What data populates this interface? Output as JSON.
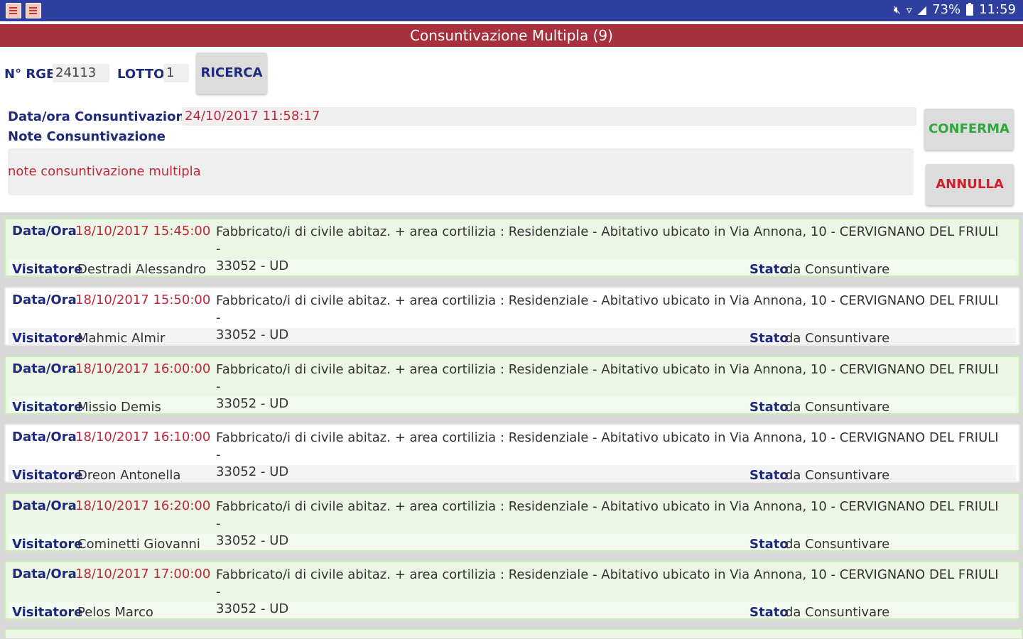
{
  "statusbar": {
    "battery": "73%",
    "time": "11:59",
    "mute_icon": "mute-icon",
    "wifi_icon": "wifi-icon",
    "signal_icon": "signal-icon"
  },
  "title": "Consuntivazione Multipla (9)",
  "search": {
    "rge_label": "N° RGE",
    "rge_value": "24113",
    "lotto_label": "LOTTO",
    "lotto_value": "1",
    "button": "RICERCA"
  },
  "form": {
    "date_label": "Data/ora Consuntivazione",
    "date_value": "24/10/2017 11:58:17",
    "notes_label": "Note Consuntivazione",
    "notes_value": "note consuntivazione multipla",
    "confirm": "CONFERMA",
    "cancel": "ANNULLA"
  },
  "labels": {
    "date": "Data/Ora",
    "visitor": "Visitatore",
    "status": "Stato"
  },
  "colors": {
    "statusbar": "#2f3f9f",
    "titlebar": "#a8303c",
    "label_blue": "#1f2a7a",
    "value_red": "#c0283a",
    "confirm_green": "#2fa83a"
  },
  "items": [
    {
      "date": "18/10/2017 15:45:00",
      "desc_line1": "Fabbricato/i di civile abitaz. + area cortilizia : Residenziale - Abitativo ubicato in Via Annona, 10 - CERVIGNANO DEL FRIULI -",
      "desc_line2": "33052 - UD",
      "visitor": "Destradi Alessandro",
      "status": "da Consuntivare"
    },
    {
      "date": "18/10/2017 15:50:00",
      "desc_line1": "Fabbricato/i di civile abitaz. + area cortilizia : Residenziale - Abitativo ubicato in Via Annona, 10 - CERVIGNANO DEL FRIULI -",
      "desc_line2": "33052 - UD",
      "visitor": "Mahmic Almir",
      "status": "da Consuntivare"
    },
    {
      "date": "18/10/2017 16:00:00",
      "desc_line1": "Fabbricato/i di civile abitaz. + area cortilizia : Residenziale - Abitativo ubicato in Via Annona, 10 - CERVIGNANO DEL FRIULI -",
      "desc_line2": "33052 - UD",
      "visitor": "Missio Demis",
      "status": "da Consuntivare"
    },
    {
      "date": "18/10/2017 16:10:00",
      "desc_line1": "Fabbricato/i di civile abitaz. + area cortilizia : Residenziale - Abitativo ubicato in Via Annona, 10 - CERVIGNANO DEL FRIULI -",
      "desc_line2": "33052 - UD",
      "visitor": "Dreon  Antonella",
      "status": "da Consuntivare"
    },
    {
      "date": "18/10/2017 16:20:00",
      "desc_line1": "Fabbricato/i di civile abitaz. + area cortilizia : Residenziale - Abitativo ubicato in Via Annona, 10 - CERVIGNANO DEL FRIULI -",
      "desc_line2": "33052 - UD",
      "visitor": "Cominetti Giovanni",
      "status": "da Consuntivare"
    },
    {
      "date": "18/10/2017 17:00:00",
      "desc_line1": "Fabbricato/i di civile abitaz. + area cortilizia : Residenziale - Abitativo ubicato in Via Annona, 10 - CERVIGNANO DEL FRIULI -",
      "desc_line2": "33052 - UD",
      "visitor": "Pelos Marco",
      "status": "da Consuntivare"
    }
  ]
}
